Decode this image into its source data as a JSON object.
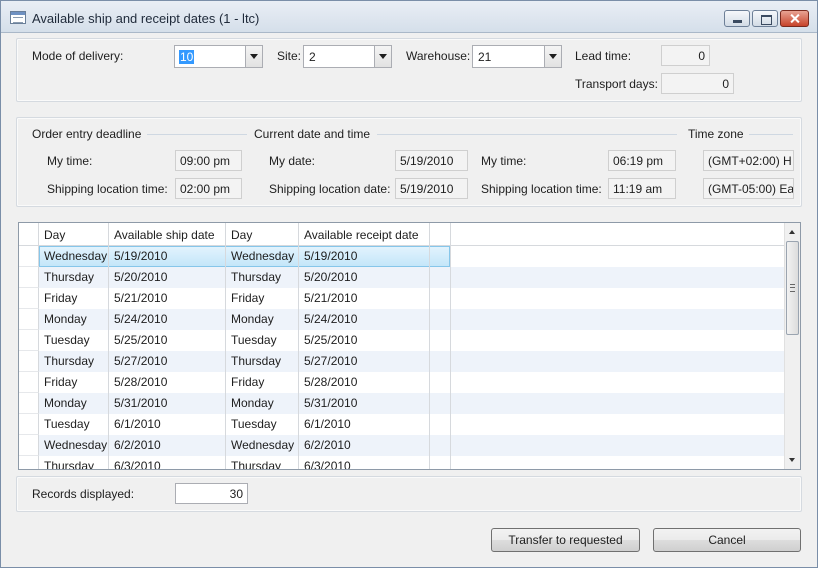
{
  "window": {
    "title": "Available ship and receipt dates (1 - ltc)"
  },
  "top": {
    "mode_label": "Mode of delivery:",
    "mode_value": "10",
    "site_label": "Site:",
    "site_value": "2",
    "warehouse_label": "Warehouse:",
    "warehouse_value": "21",
    "lead_time_label": "Lead time:",
    "lead_time_value": "0",
    "transport_days_label": "Transport days:",
    "transport_days_value": "0"
  },
  "deadline": {
    "heading": "Order entry deadline",
    "my_time_label": "My time:",
    "my_time_value": "09:00 pm",
    "ship_time_label": "Shipping location time:",
    "ship_time_value": "02:00 pm"
  },
  "current": {
    "heading": "Current date and time",
    "my_date_label": "My date:",
    "my_date_value": "5/19/2010",
    "ship_date_label": "Shipping location date:",
    "ship_date_value": "5/19/2010",
    "my_time_label": "My time:",
    "my_time_value": "06:19 pm",
    "ship_time_label": "Shipping location time:",
    "ship_time_value": "11:19 am"
  },
  "timezone": {
    "heading": "Time zone",
    "mine": "(GMT+02:00) H",
    "shipping": "(GMT-05:00) Ea"
  },
  "grid": {
    "columns": [
      "Day",
      "Available ship date",
      "Day",
      "Available receipt date"
    ],
    "rows": [
      [
        "Wednesday",
        "5/19/2010",
        "Wednesday",
        "5/19/2010"
      ],
      [
        "Thursday",
        "5/20/2010",
        "Thursday",
        "5/20/2010"
      ],
      [
        "Friday",
        "5/21/2010",
        "Friday",
        "5/21/2010"
      ],
      [
        "Monday",
        "5/24/2010",
        "Monday",
        "5/24/2010"
      ],
      [
        "Tuesday",
        "5/25/2010",
        "Tuesday",
        "5/25/2010"
      ],
      [
        "Thursday",
        "5/27/2010",
        "Thursday",
        "5/27/2010"
      ],
      [
        "Friday",
        "5/28/2010",
        "Friday",
        "5/28/2010"
      ],
      [
        "Monday",
        "5/31/2010",
        "Monday",
        "5/31/2010"
      ],
      [
        "Tuesday",
        "6/1/2010",
        "Tuesday",
        "6/1/2010"
      ],
      [
        "Wednesday",
        "6/2/2010",
        "Wednesday",
        "6/2/2010"
      ],
      [
        "Thursday",
        "6/3/2010",
        "Thursday",
        "6/3/2010"
      ]
    ]
  },
  "footer": {
    "records_label": "Records displayed:",
    "records_value": "30",
    "transfer_label": "Transfer to requested",
    "cancel_label": "Cancel"
  }
}
